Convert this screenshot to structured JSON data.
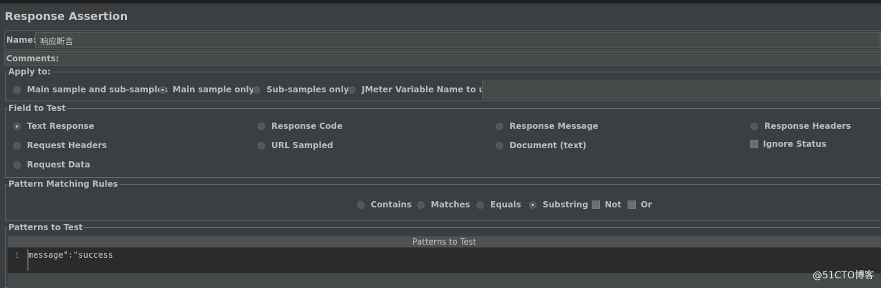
{
  "title": "Response Assertion",
  "name": {
    "label": "Name:",
    "value": "响应断言"
  },
  "comments": {
    "label": "Comments:",
    "value": ""
  },
  "apply_to": {
    "legend": "Apply to:",
    "options": [
      {
        "label": "Main sample and sub-samples",
        "selected": false
      },
      {
        "label": "Main sample only",
        "selected": true
      },
      {
        "label": "Sub-samples only",
        "selected": false
      },
      {
        "label": "JMeter Variable Name to use",
        "selected": false
      }
    ],
    "variable_value": ""
  },
  "field_to_test": {
    "legend": "Field to Test",
    "options": [
      {
        "label": "Text Response",
        "selected": true
      },
      {
        "label": "Response Code",
        "selected": false
      },
      {
        "label": "Response Message",
        "selected": false
      },
      {
        "label": "Response Headers",
        "selected": false
      },
      {
        "label": "Request Headers",
        "selected": false
      },
      {
        "label": "URL Sampled",
        "selected": false
      },
      {
        "label": "Document (text)",
        "selected": false
      },
      {
        "label": "Request Data",
        "selected": false
      }
    ],
    "ignore_status": {
      "label": "Ignore Status",
      "checked": false
    }
  },
  "pattern_rules": {
    "legend": "Pattern Matching Rules",
    "options": [
      {
        "label": "Contains",
        "selected": false
      },
      {
        "label": "Matches",
        "selected": false
      },
      {
        "label": "Equals",
        "selected": false
      },
      {
        "label": "Substring",
        "selected": true
      }
    ],
    "not": {
      "label": "Not",
      "checked": false
    },
    "or": {
      "label": "Or",
      "checked": false
    }
  },
  "patterns": {
    "legend": "Patterns to Test",
    "column_header": "Patterns to Test",
    "line_number": "1",
    "line_text": "message\":\"success"
  },
  "watermark": "@51CTO博客"
}
